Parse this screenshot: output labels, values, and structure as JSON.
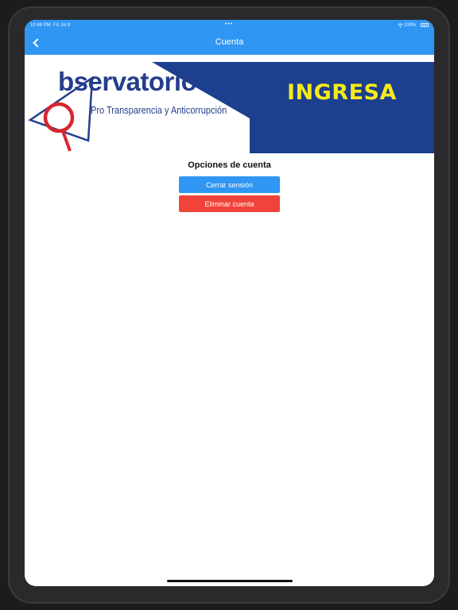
{
  "status_bar": {
    "time": "10:48 PM",
    "date": "Fri Jul 8",
    "dots": "•••",
    "battery_text": "100%"
  },
  "nav": {
    "title": "Cuenta",
    "back_icon": "chevron-left-icon"
  },
  "banner": {
    "cta_text": "INGRESA",
    "logo_word": "bservatorio",
    "logo_letter": "O",
    "logo_tagline": "Pro Transparencia y Anticorrupción",
    "colors": {
      "navy": "#1c3f8f",
      "yellow": "#f5ea1a",
      "logo_red": "#d7262d",
      "logo_blue": "#243e8c"
    }
  },
  "account": {
    "section_title": "Opciones de cuenta",
    "logout_label": "Cerrar sensión",
    "delete_label": "Eliminar cuenta",
    "colors": {
      "logout": "#2f96f3",
      "delete": "#f0443a"
    }
  }
}
